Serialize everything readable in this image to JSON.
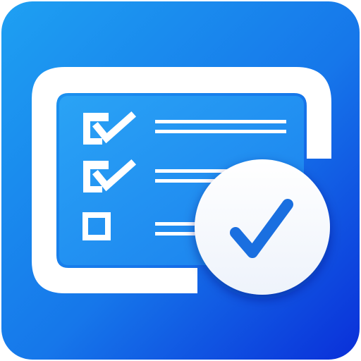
{
  "app_icon": {
    "name": "checklist-app-icon",
    "colors": {
      "gradient_top_left": "#1ea0f2",
      "gradient_bottom_right": "#0a2fd9",
      "inner_panel": "#2196f3",
      "foreground": "#ffffff",
      "check_blue": "#1a73e8"
    },
    "checklist": {
      "items": [
        {
          "icon": "checked-box-icon",
          "checked": true
        },
        {
          "icon": "checked-box-icon",
          "checked": true
        },
        {
          "icon": "empty-box-icon",
          "checked": false
        }
      ]
    },
    "badge": {
      "icon": "checkmark-icon"
    }
  }
}
